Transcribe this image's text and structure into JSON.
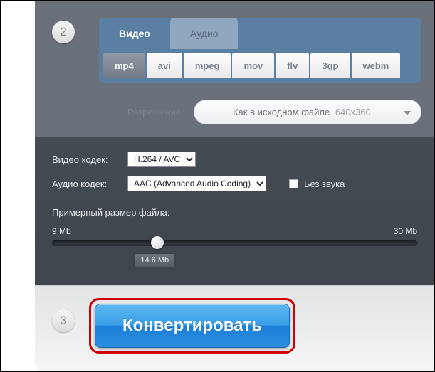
{
  "steps": {
    "s2": "2",
    "s3": "3"
  },
  "mediaTabs": {
    "video": "Видео",
    "audio": "Аудио"
  },
  "formats": {
    "mp4": "mp4",
    "avi": "avi",
    "mpeg": "mpeg",
    "mov": "mov",
    "flv": "flv",
    "3gp": "3gp",
    "webm": "webm"
  },
  "resolution": {
    "label": "Разрешение:",
    "value": "Как в исходном файле",
    "dim": "640x360"
  },
  "codecs": {
    "videoLabel": "Видео кодек:",
    "videoValue": "H.264 / AVC",
    "audioLabel": "Аудио кодек:",
    "audioValue": "AAC (Advanced Audio Coding)",
    "muteLabel": "Без звука"
  },
  "size": {
    "label": "Примерный размер файла:",
    "min": "9 Mb",
    "max": "30 Mb",
    "value": "14.6 Mb"
  },
  "convert": "Конвертировать"
}
